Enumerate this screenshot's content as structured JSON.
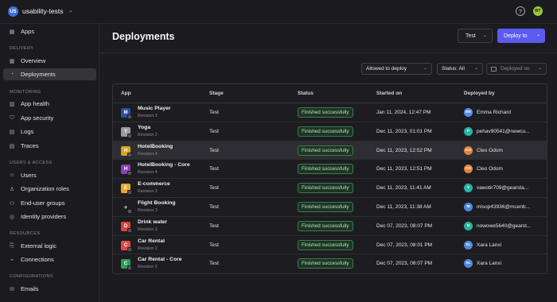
{
  "workspace": {
    "initials": "US",
    "name": "usability-tests"
  },
  "topbar": {
    "help_glyph": "?",
    "user_initials": "RT"
  },
  "sidebar": {
    "apps": "Apps",
    "sections": {
      "delivery": "DELIVERY",
      "monitoring": "MONITORING",
      "users_access": "USERS & ACCESS",
      "resources": "RESOURCES",
      "configurations": "CONFIGURATIONS"
    },
    "items": {
      "overview": "Overview",
      "deployments": "Deployments",
      "app_health": "App health",
      "app_security": "App security",
      "logs": "Logs",
      "traces": "Traces",
      "users": "Users",
      "org_roles": "Organization roles",
      "end_user_groups": "End-user groups",
      "identity_providers": "Identity providers",
      "external_logic": "External logic",
      "connections": "Connections",
      "emails": "Emails"
    }
  },
  "header": {
    "title": "Deployments",
    "environment": "Test",
    "deploy_button": "Deploy to"
  },
  "filters": {
    "allowed": "Allowed to deploy",
    "status": "Status: All",
    "deployed_on": "Deployed on"
  },
  "table": {
    "columns": [
      "App",
      "Stage",
      "Status",
      "Started on",
      "Deployed by"
    ],
    "rows": [
      {
        "name": "Music Player",
        "revision": "Revision 3",
        "stage": "Test",
        "status": "Finished successfully",
        "started": "Jan 11, 2024, 12:47 PM",
        "by_initials": "ER",
        "by": "Emma Richard",
        "icon_letter": "M",
        "icon_color": "#2d4f9e",
        "avatar_color": "#5b8def"
      },
      {
        "name": "Yoga",
        "revision": "Revision 2",
        "stage": "Test",
        "status": "Finished successfully",
        "started": "Dec 11, 2023, 01:01 PM",
        "by_initials": "P",
        "by": "pehav90541@newcu...",
        "icon_letter": "Y",
        "icon_color": "#9a9aa3",
        "avatar_color": "#2bb3a3"
      },
      {
        "name": "HotelBooking",
        "revision": "Revision 4",
        "stage": "Test",
        "status": "Finished successfully",
        "started": "Dec 11, 2023, 12:52 PM",
        "by_initials": "CO",
        "by": "Cleo Odom",
        "icon_letter": "H",
        "icon_color": "#d6a423",
        "avatar_color": "#e2813b"
      },
      {
        "name": "HotelBooking - Core",
        "revision": "Revision 4",
        "stage": "Test",
        "status": "Finished successfully",
        "started": "Dec 11, 2023, 12:51 PM",
        "by_initials": "CO",
        "by": "Cleo Odom",
        "icon_letter": "H",
        "icon_color": "#8d3fb8",
        "avatar_color": "#e2813b"
      },
      {
        "name": "E-commerce",
        "revision": "Revision 2",
        "stage": "Test",
        "status": "Finished successfully",
        "started": "Dec 11, 2023, 11:41 AM",
        "by_initials": "V",
        "by": "vawotir709@gearsta...",
        "icon_letter": "E",
        "icon_color": "#e8a72a",
        "avatar_color": "#2bb3a3"
      },
      {
        "name": "Flight Booking",
        "revision": "Revision 3",
        "stage": "Test",
        "status": "Finished successfully",
        "started": "Dec 11, 2023, 11:38 AM",
        "by_initials": "M",
        "by": "misop43936@mcenb...",
        "icon_letter": "✈",
        "icon_color": "#1d1d21",
        "avatar_color": "#4f8ad9"
      },
      {
        "name": "Drink water",
        "revision": "Revision 3",
        "stage": "Test",
        "status": "Finished successfully",
        "started": "Dec 07, 2023, 08:07 PM",
        "by_initials": "N",
        "by": "nowowe5640@gearst...",
        "icon_letter": "D",
        "icon_color": "#d9443b",
        "avatar_color": "#2bb3a3"
      },
      {
        "name": "Car Rental",
        "revision": "Revision 2",
        "stage": "Test",
        "status": "Finished successfully",
        "started": "Dec 07, 2023, 08:01 PM",
        "by_initials": "XL",
        "by": "Xara Lanxi",
        "icon_letter": "C",
        "icon_color": "#e34848",
        "avatar_color": "#4f8ad9"
      },
      {
        "name": "Car Rental - Core",
        "revision": "Revision 2",
        "stage": "Test",
        "status": "Finished successfully",
        "started": "Dec 07, 2023, 08:07 PM",
        "by_initials": "XL",
        "by": "Xara Lanxi",
        "icon_letter": "C",
        "icon_color": "#2f9a5a",
        "avatar_color": "#4f8ad9"
      }
    ]
  },
  "colors": {
    "accent": "#5b5bf0",
    "success_bg": "#1e3424",
    "success_border": "#3c7a4a"
  }
}
